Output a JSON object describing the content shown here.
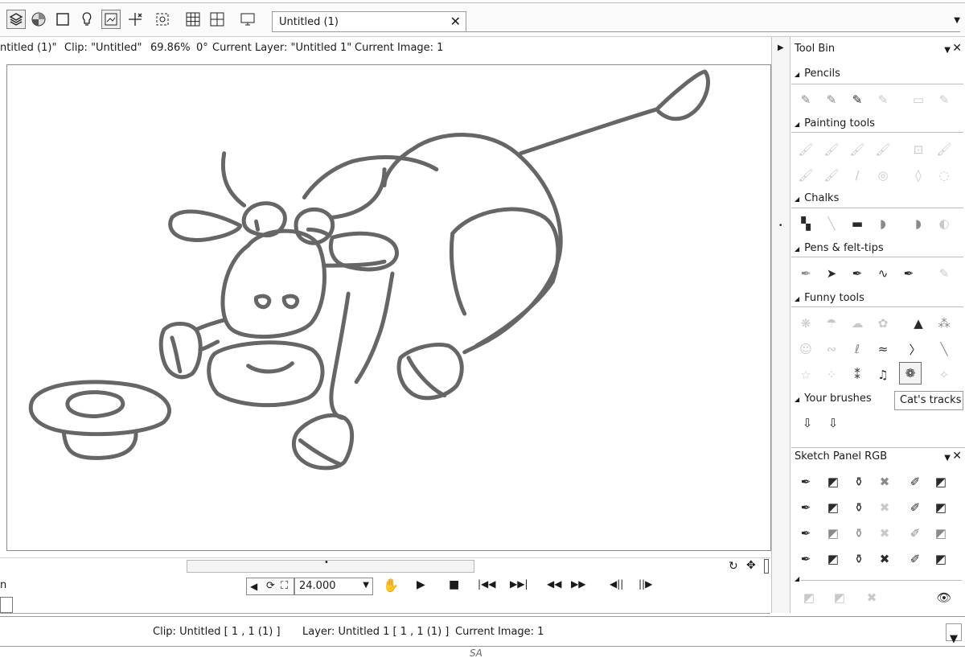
{
  "toolbar": {
    "document_tab": "Untitled (1)",
    "close_glyph": "✕",
    "dropdown_glyph": "▼"
  },
  "infoline": {
    "title": "ntitled (1)\"",
    "clip": "Clip: \"Untitled\"",
    "zoom": "69.86%",
    "angle": "0°",
    "layer": "Current Layer: \"Untitled 1\"",
    "image": "Current Image: 1"
  },
  "player": {
    "left_label": "n",
    "fps": "24.000"
  },
  "toolbin": {
    "title": "Tool Bin",
    "sections": [
      {
        "label": "Pencils"
      },
      {
        "label": "Painting tools"
      },
      {
        "label": "Chalks"
      },
      {
        "label": "Pens & felt-tips"
      },
      {
        "label": "Funny tools"
      },
      {
        "label": "Your brushes"
      }
    ],
    "tooltip": "Cat's tracks"
  },
  "sketch_panel": {
    "title": "Sketch Panel RGB"
  },
  "statusbar": {
    "clip": "Clip: Untitled [ 1 , 1  (1) ]",
    "layer": "Layer: Untitled 1 [ 1 , 1  (1) ]",
    "image": "Current Image: 1"
  },
  "footer": {
    "logo": "SA"
  },
  "icons": {
    "layers": "layers-icon",
    "color_wheel": "color-wheel-icon",
    "rect": "rectangle-icon",
    "bulb": "light-bulb-icon",
    "grid": "grid-icon",
    "eye": "eye-icon",
    "cat_tracks": "paw-icon"
  }
}
